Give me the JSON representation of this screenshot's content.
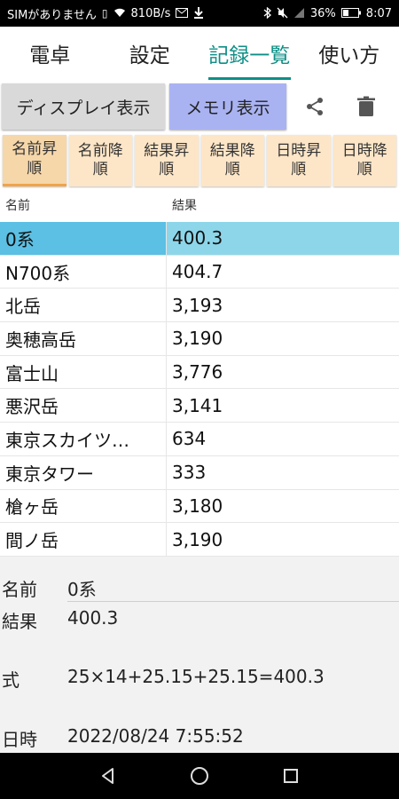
{
  "status_bar": {
    "carrier": "SIMがありません",
    "net_speed": "810B/s",
    "battery": "36%",
    "time": "8:07"
  },
  "tabs": [
    {
      "label": "電卓"
    },
    {
      "label": "設定"
    },
    {
      "label": "記録一覧"
    },
    {
      "label": "使い方"
    }
  ],
  "toolbar": {
    "display_button": "ディスプレイ表示",
    "memory_button": "メモリ表示"
  },
  "sort_buttons": [
    {
      "line1": "名前昇",
      "line2": "順"
    },
    {
      "line1": "名前降",
      "line2": "順"
    },
    {
      "line1": "結果昇",
      "line2": "順"
    },
    {
      "line1": "結果降",
      "line2": "順"
    },
    {
      "line1": "日時昇",
      "line2": "順"
    },
    {
      "line1": "日時降",
      "line2": "順"
    }
  ],
  "table": {
    "headers": {
      "name": "名前",
      "result": "結果"
    },
    "rows": [
      {
        "name": "0系",
        "result": "400.3"
      },
      {
        "name": "N700系",
        "result": "404.7"
      },
      {
        "name": "北岳",
        "result": "3,193"
      },
      {
        "name": "奥穂高岳",
        "result": "3,190"
      },
      {
        "name": "富士山",
        "result": "3,776"
      },
      {
        "name": "悪沢岳",
        "result": "3,141"
      },
      {
        "name": "東京スカイツ…",
        "result": "634"
      },
      {
        "name": "東京タワー",
        "result": "333"
      },
      {
        "name": "槍ヶ岳",
        "result": "3,180"
      },
      {
        "name": "間ノ岳",
        "result": "3,190"
      }
    ]
  },
  "detail": {
    "name_label": "名前",
    "name_value": "0系",
    "result_label": "結果",
    "result_value": "400.3",
    "formula_label": "式",
    "formula_value": "25×14+25.15+25.15=400.3",
    "datetime_label": "日時",
    "datetime_value": "2022/08/24 7:55:52"
  },
  "colors": {
    "accent": "#0e8f86",
    "memory_button": "#a9b3f2",
    "sort_button": "#fde6c7",
    "selected_row": "#8dd6ea"
  }
}
